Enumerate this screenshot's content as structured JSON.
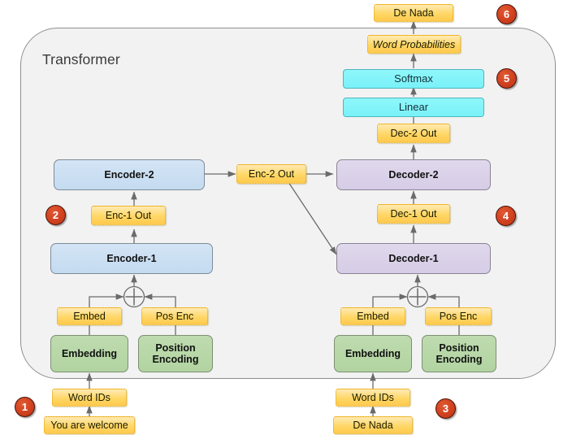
{
  "diagram": {
    "title": "Transformer",
    "container_label": "Transformer"
  },
  "badges": [
    {
      "id": "badge-1",
      "label": "1"
    },
    {
      "id": "badge-2",
      "label": "2"
    },
    {
      "id": "badge-3",
      "label": "3"
    },
    {
      "id": "badge-4",
      "label": "4"
    },
    {
      "id": "badge-5",
      "label": "5"
    },
    {
      "id": "badge-6",
      "label": "6"
    }
  ],
  "encoder_stack": {
    "input_sentence": "You are welcome",
    "word_ids": "Word IDs",
    "embedding_layer": "Embedding",
    "position_encoding_layer": "Position\nEncoding",
    "embed_note": "Embed",
    "pos_enc_note": "Pos Enc",
    "encoder_1": "Encoder-1",
    "enc_1_out": "Enc-1 Out",
    "encoder_2": "Encoder-2",
    "enc_2_out": "Enc-2 Out"
  },
  "decoder_stack": {
    "input_sentence": "De Nada",
    "word_ids": "Word IDs",
    "embedding_layer": "Embedding",
    "position_encoding_layer": "Position\nEncoding",
    "embed_note": "Embed",
    "pos_enc_note": "Pos Enc",
    "decoder_1": "Decoder-1",
    "dec_1_out": "Dec-1 Out",
    "decoder_2": "Decoder-2",
    "dec_2_out": "Dec-2 Out"
  },
  "output_head": {
    "linear": "Linear",
    "softmax": "Softmax",
    "word_probabilities": "Word Probabilities",
    "output_sentence": "De Nada"
  },
  "colors": {
    "canvas": "#ffffff",
    "container_fill": "#f2f2f2",
    "container_stroke": "#8f8f8f",
    "encoder_fill": "#c9ddf0",
    "decoder_fill": "#dbd2e8",
    "green_fill": "#b7d6a6",
    "cyan_fill": "#84f4f9",
    "note_fill": "#ffd766",
    "note_stroke": "#e0a000",
    "badge_fill": "#cc3d1c",
    "edge_stroke": "#666666"
  }
}
